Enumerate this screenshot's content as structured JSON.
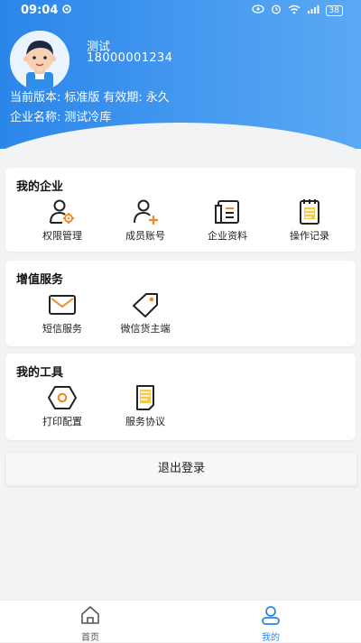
{
  "status_bar": {
    "time": "09:04",
    "battery": "38"
  },
  "profile": {
    "name": "测试",
    "phone": "18000001234",
    "version_label": "当前版本:",
    "version_value": "标准版",
    "validity_label": "有效期:",
    "validity_value": "永久",
    "company_label": "企业名称:",
    "company_value": "测试冷库"
  },
  "sections": [
    {
      "title": "我的企业",
      "items": [
        {
          "label": "权限管理",
          "icon": "permission-icon"
        },
        {
          "label": "成员账号",
          "icon": "add-member-icon"
        },
        {
          "label": "企业资料",
          "icon": "company-info-icon"
        },
        {
          "label": "操作记录",
          "icon": "operation-log-icon"
        }
      ]
    },
    {
      "title": "增值服务",
      "items": [
        {
          "label": "短信服务",
          "icon": "sms-icon"
        },
        {
          "label": "微信货主端",
          "icon": "tag-icon"
        }
      ]
    },
    {
      "title": "我的工具",
      "items": [
        {
          "label": "打印配置",
          "icon": "print-config-icon"
        },
        {
          "label": "服务协议",
          "icon": "agreement-icon"
        }
      ]
    }
  ],
  "logout_label": "退出登录",
  "tabbar": {
    "home_label": "首页",
    "mine_label": "我的"
  },
  "colors": {
    "accent": "#2b86ea",
    "icon_accent": "#f08a24"
  }
}
